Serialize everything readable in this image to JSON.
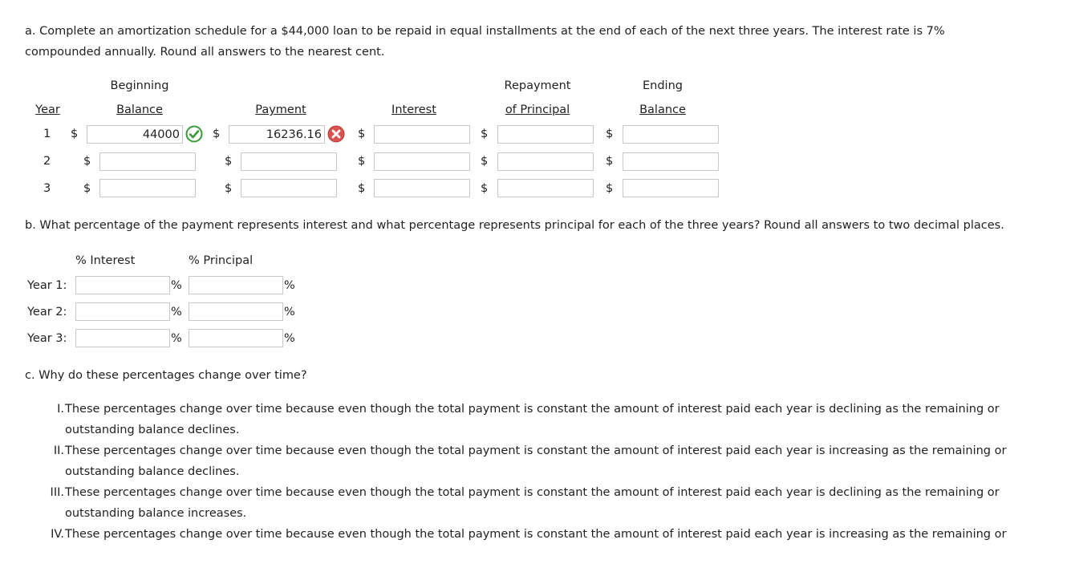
{
  "part_a": {
    "question_line1": "a. Complete an amortization schedule for a $44,000 loan to be repaid in equal installments at the end of each of the next three years. The interest rate is 7%",
    "question_line2": "compounded annually. Round all answers to the nearest cent.",
    "headers": {
      "year": "Year",
      "beginning_top": "Beginning",
      "beginning_bottom": "Balance",
      "payment": "Payment",
      "interest": "Interest",
      "repayment_top": "Repayment",
      "repayment_bottom": "of Principal",
      "ending_top": "Ending",
      "ending_bottom": "Balance"
    },
    "currency_symbol": "$",
    "rows": [
      {
        "year": "1",
        "beginning_balance": "44000",
        "payment": "16236.16",
        "interest": "",
        "repayment": "",
        "ending_balance": "",
        "beginning_status": "correct",
        "payment_status": "incorrect"
      },
      {
        "year": "2",
        "beginning_balance": "",
        "payment": "",
        "interest": "",
        "repayment": "",
        "ending_balance": ""
      },
      {
        "year": "3",
        "beginning_balance": "",
        "payment": "",
        "interest": "",
        "repayment": "",
        "ending_balance": ""
      }
    ],
    "status_icons": {
      "correct": "check-circle-icon",
      "incorrect": "x-circle-icon",
      "correct_color": "#3a9a3a",
      "incorrect_color": "#d9534f"
    }
  },
  "part_b": {
    "question": "b. What percentage of the payment represents interest and what percentage represents principal for each of the three years? Round all answers to two decimal places.",
    "col_interest": "% Interest",
    "col_principal": "% Principal",
    "percent_sign": "%",
    "rows": [
      {
        "label": "Year 1:",
        "interest": "",
        "principal": ""
      },
      {
        "label": "Year 2:",
        "interest": "",
        "principal": ""
      },
      {
        "label": "Year 3:",
        "interest": "",
        "principal": ""
      }
    ]
  },
  "part_c": {
    "question": "c. Why do these percentages change over time?",
    "options": [
      {
        "num": "I.",
        "line1": "These percentages change over time because even though the total payment is constant the amount of interest paid each year is declining as the remaining or",
        "line2": "outstanding balance declines."
      },
      {
        "num": "II.",
        "line1": "These percentages change over time because even though the total payment is constant the amount of interest paid each year is increasing as the remaining or",
        "line2": "outstanding balance declines."
      },
      {
        "num": "III.",
        "line1": "These percentages change over time because even though the total payment is constant the amount of interest paid each year is declining as the remaining or",
        "line2": "outstanding balance increases."
      },
      {
        "num": "IV.",
        "line1": "These percentages change over time because even though the total payment is constant the amount of interest paid each year is increasing as the remaining or",
        "line2": ""
      }
    ]
  }
}
